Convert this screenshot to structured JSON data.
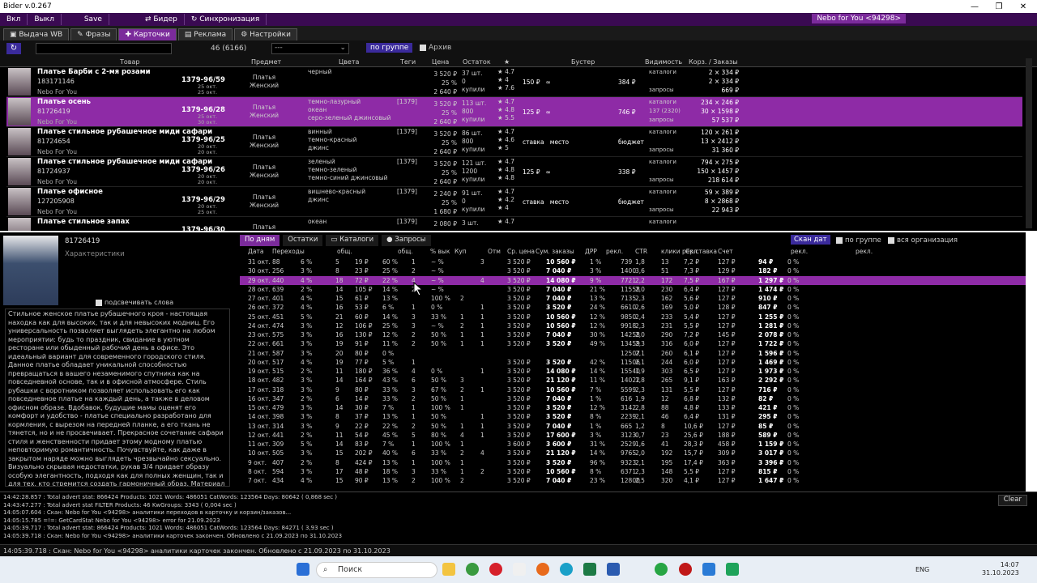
{
  "window": {
    "title": "Bider v.0.267"
  },
  "menu": {
    "items": [
      "Вкл",
      "Выкл",
      "Save",
      "Бидер",
      "Синхронизация"
    ],
    "account": "Nebo for You <94298>"
  },
  "tabs": [
    "Выдача WB",
    "Фразы",
    "Карточки",
    "Реклама",
    "Настройки"
  ],
  "toolbar": {
    "count": "46 (6166)",
    "dropdown": "---",
    "group_button": "по группе",
    "archive": "Архив"
  },
  "columns": [
    "Товар",
    "Предмет",
    "Цвета",
    "Теги",
    "Цена",
    "Остаток",
    "★",
    "Бустер",
    "Видимость",
    "Корз. / Заказы"
  ],
  "products": [
    {
      "name": "Платье Барби с 2-мя розами",
      "id": "183171146",
      "brand": "Nebo For You",
      "article": "1379-96/59",
      "dates": "25 окт.\n25 окт.",
      "subject": "Платья\nЖенский",
      "colors": "черный",
      "tags": "",
      "price": "3 520 ₽\n25 %\n2 640 ₽",
      "stock": "37 шт.\n0\nкупили",
      "rating": "★ 4.7\n★ 4\n★ 7.6",
      "boost": "150 ₽   ∞",
      "budget": "384 ₽",
      "vis": "каталоги\n\nзапросы",
      "orders": "2 × 334 ₽\n2 × 334 ₽\n669 ₽"
    },
    {
      "name": "Платье осень",
      "id": "81726419",
      "brand": "Nebo For You",
      "article": "1379-96/28",
      "dates": "25 окт.\n30 окт.",
      "subject": "Платья\nЖенский",
      "colors": "темно-лазурный\nокеан\nсеро-зеленый джинсовый",
      "tags": "[1379]",
      "price": "3 520 ₽\n25 %\n2 640 ₽",
      "stock": "113 шт.\n800\nкупили",
      "rating": "★ 4.7\n★ 4.8\n★ 5.5",
      "boost": "125 ₽   ∞",
      "budget": "746 ₽",
      "vis": "каталоги\n137 (2320)\nзапросы",
      "orders": "234 × 246 ₽\n30 × 1598 ₽\n57 537 ₽"
    },
    {
      "name": "Платье стильное рубашечное миди сафари",
      "id": "81724654",
      "brand": "Nebo For You",
      "article": "1379-96/25",
      "dates": "20 окт.\n20 окт.",
      "subject": "Платья\nЖенский",
      "colors": "винный\nтемно-красный\nджинс",
      "tags": "[1379]",
      "price": "3 520 ₽\n25 %\n2 640 ₽",
      "stock": "86 шт.\n800\nкупили",
      "rating": "★ 4.7\n★ 4.6\n★ 5",
      "boost": "ставка   место",
      "budget": "бюджет",
      "vis": "каталоги\n\nзапросы",
      "orders": "120 × 261 ₽\n13 × 2412 ₽\n31 360 ₽"
    },
    {
      "name": "Платье стильное рубашечное миди сафари",
      "id": "81724937",
      "brand": "Nebo For You",
      "article": "1379-96/26",
      "dates": "20 окт.\n20 окт.",
      "subject": "Платья\nЖенский",
      "colors": "зеленый\nтемно-зеленый\nтемно-синий джинсовый",
      "tags": "[1379]",
      "price": "3 520 ₽\n25 %\n2 640 ₽",
      "stock": "121 шт.\n1200\nкупили",
      "rating": "★ 4.7\n★ 4.8\n★ 4.8",
      "boost": "125 ₽   ∞",
      "budget": "338 ₽",
      "vis": "каталоги\n\nзапросы",
      "orders": "794 × 275 ₽\n150 × 1457 ₽\n218 614 ₽"
    },
    {
      "name": "Платье офисное",
      "id": "127205908",
      "brand": "Nebo For You",
      "article": "1379-96/29",
      "dates": "20 окт.\n25 окт.",
      "subject": "Платья\nЖенский",
      "colors": "вишнево-красный\nджинс",
      "tags": "[1379]",
      "price": "2 240 ₽\n25 %\n1 680 ₽",
      "stock": "91 шт.\n0\nкупили",
      "rating": "★ 4.7\n★ 4.2\n★ 4",
      "boost": "ставка   место",
      "budget": "бюджет",
      "vis": "каталоги\n\nзапросы",
      "orders": "59 × 389 ₽\n8 × 2868 ₽\n22 943 ₽"
    },
    {
      "name": "Платье стильное запах",
      "id": "",
      "brand": "",
      "article": "1379-96/30",
      "dates": "",
      "subject": "Платья",
      "colors": "океан",
      "tags": "[1379]",
      "price": "2 080 ₽",
      "stock": "3 шт.",
      "rating": "★ 4.7",
      "boost": "",
      "budget": "",
      "vis": "каталоги",
      "orders": ""
    }
  ],
  "detail": {
    "id": "81726419",
    "characteristics": "Характеристики",
    "highlight_words": "подсвечивать слова",
    "description": "Стильное женское платье рубашечного кроя - настоящая находка как для высоких, так и для невысоких модниц. Его универсальность позволяет выглядеть элегантно на любом мероприятии: будь то праздник, свидание в уютном ресторане или обыденный рабочий день в офисе. Это идеальный вариант для современного городского стиля. Данное платье обладает уникальной способностью превращаться в вашего незаменимого спутника как на повседневной основе, так и в офисной атмосфере. Стиль рубашки с воротником позволяет использовать его как повседневное платье на каждый день, а также в деловом офисном образе. Вдобавок, будущие мамы оценят его комфорт и удобство - платье специально разработано для кормления, с вырезом на передней планке, а его ткань не тянется, но и не просвечивает. Прекрасное сочетание сафари стиля и женственности придает этому модному платью неповторимую романтичность. Почувствуйте, как даже в закрытом наряде можно выглядеть чрезвычайно сексуально. Визуально скрывая недостатки, рукав 3/4 придает образу особую элегантность, подходя как для полных женщин, так и для тех, кто стремится создать гармоничный образ. Материал платья обладает плотностью, что делает его"
  },
  "stats_tabs": [
    "По дням",
    "Остатки",
    "Каталоги",
    "Запросы"
  ],
  "stats_controls": {
    "scan": "Скан дат",
    "group": "по группе",
    "all_org": "вся организация"
  },
  "stats_headers": [
    "Дата",
    "Переходы",
    "общ.",
    "общ.",
    "% вык",
    "Куп",
    "Отм",
    "Ср. цена",
    "Сум. заказы",
    "ДРР",
    "рекл.",
    "CTR",
    "клики рекл.",
    "Ср.ставка",
    "Счет",
    "рекл.",
    "рекл."
  ],
  "stats_rows": [
    [
      "31 окт.",
      "88",
      "6 %",
      "5",
      "19 ₽",
      "60 %",
      "1",
      "~ %",
      "",
      "3",
      "3 520 ₽",
      "10 560 ₽",
      "1 %",
      "739",
      "1,8",
      "13",
      "7,2 ₽",
      "127 ₽",
      "94 ₽",
      "0 %"
    ],
    [
      "30 окт.",
      "256",
      "3 %",
      "8",
      "23 ₽",
      "25 %",
      "2",
      "~ %",
      "",
      "",
      "3 520 ₽",
      "7 040 ₽",
      "3 %",
      "1400",
      "3,6",
      "51",
      "7,3 ₽",
      "129 ₽",
      "182 ₽",
      "0 %"
    ],
    [
      "29 окт.",
      "440",
      "4 %",
      "18",
      "72 ₽",
      "22 %",
      "4",
      "~ %",
      "",
      "4",
      "3 520 ₽",
      "14 080 ₽",
      "9 %",
      "7721",
      "2,2",
      "172",
      "7,5 ₽",
      "167 ₽",
      "1 297 ₽",
      "0 %"
    ],
    [
      "28 окт.",
      "639",
      "2 %",
      "14",
      "105 ₽",
      "14 %",
      "2",
      "~ %",
      "",
      "",
      "3 520 ₽",
      "7 040 ₽",
      "21 %",
      "11558",
      "2,0",
      "230",
      "6,4 ₽",
      "127 ₽",
      "1 474 ₽",
      "0 %"
    ],
    [
      "27 окт.",
      "401",
      "4 %",
      "15",
      "61 ₽",
      "13 %",
      "",
      "100 %",
      "2",
      "",
      "3 520 ₽",
      "7 040 ₽",
      "13 %",
      "7135",
      "2,3",
      "162",
      "5,6 ₽",
      "127 ₽",
      "910 ₽",
      "0 %"
    ],
    [
      "26 окт.",
      "372",
      "4 %",
      "16",
      "53 ₽",
      "6 %",
      "1",
      "0 %",
      "",
      "1",
      "3 520 ₽",
      "3 520 ₽",
      "24 %",
      "6610",
      "2,6",
      "169",
      "5,0 ₽",
      "128 ₽",
      "847 ₽",
      "0 %"
    ],
    [
      "25 окт.",
      "451",
      "5 %",
      "21",
      "60 ₽",
      "14 %",
      "3",
      "33 %",
      "1",
      "1",
      "3 520 ₽",
      "10 560 ₽",
      "12 %",
      "9850",
      "2,4",
      "233",
      "5,4 ₽",
      "127 ₽",
      "1 255 ₽",
      "0 %"
    ],
    [
      "24 окт.",
      "474",
      "3 %",
      "12",
      "106 ₽",
      "25 %",
      "3",
      "~ %",
      "2",
      "1",
      "3 520 ₽",
      "10 560 ₽",
      "12 %",
      "9918",
      "2,3",
      "231",
      "5,5 ₽",
      "127 ₽",
      "1 281 ₽",
      "0 %"
    ],
    [
      "23 окт.",
      "575",
      "3 %",
      "16",
      "130 ₽",
      "12 %",
      "2",
      "50 %",
      "1",
      "1",
      "3 520 ₽",
      "7 040 ₽",
      "30 %",
      "14258",
      "2,0",
      "290",
      "7,2 ₽",
      "145 ₽",
      "2 078 ₽",
      "0 %"
    ],
    [
      "22 окт.",
      "661",
      "3 %",
      "19",
      "91 ₽",
      "11 %",
      "2",
      "50 %",
      "1",
      "1",
      "3 520 ₽",
      "3 520 ₽",
      "49 %",
      "13459",
      "2,3",
      "316",
      "6,0 ₽",
      "127 ₽",
      "1 722 ₽",
      "0 %"
    ],
    [
      "21 окт.",
      "587",
      "3 %",
      "20",
      "80 ₽",
      "0 %",
      "",
      "",
      "",
      "",
      "",
      "",
      "",
      "12507",
      "2,1",
      "260",
      "6,1 ₽",
      "127 ₽",
      "1 596 ₽",
      "0 %"
    ],
    [
      "20 окт.",
      "517",
      "4 %",
      "19",
      "77 ₽",
      "5 %",
      "1",
      "",
      "",
      "",
      "3 520 ₽",
      "3 520 ₽",
      "42 %",
      "11506",
      "2,1",
      "244",
      "6,0 ₽",
      "127 ₽",
      "1 469 ₽",
      "0 %"
    ],
    [
      "19 окт.",
      "515",
      "2 %",
      "11",
      "180 ₽",
      "36 %",
      "4",
      "0 %",
      "",
      "1",
      "3 520 ₽",
      "14 080 ₽",
      "14 %",
      "15540",
      "1,9",
      "303",
      "6,5 ₽",
      "127 ₽",
      "1 973 ₽",
      "0 %"
    ],
    [
      "18 окт.",
      "482",
      "3 %",
      "14",
      "164 ₽",
      "43 %",
      "6",
      "50 %",
      "3",
      "",
      "3 520 ₽",
      "21 120 ₽",
      "11 %",
      "14022",
      "1,8",
      "265",
      "9,1 ₽",
      "163 ₽",
      "2 292 ₽",
      "0 %"
    ],
    [
      "17 окт.",
      "318",
      "3 %",
      "9",
      "80 ₽",
      "33 %",
      "3",
      "67 %",
      "2",
      "1",
      "3 520 ₽",
      "10 560 ₽",
      "7 %",
      "5599",
      "2,3",
      "131",
      "5,5 ₽",
      "127 ₽",
      "716 ₽",
      "0 %"
    ],
    [
      "16 окт.",
      "347",
      "2 %",
      "6",
      "14 ₽",
      "33 %",
      "2",
      "50 %",
      "1",
      "",
      "3 520 ₽",
      "7 040 ₽",
      "1 %",
      "616",
      "1,9",
      "12",
      "6,8 ₽",
      "132 ₽",
      "82 ₽",
      "0 %"
    ],
    [
      "15 окт.",
      "479",
      "3 %",
      "14",
      "30 ₽",
      "7 %",
      "1",
      "100 %",
      "1",
      "",
      "3 520 ₽",
      "3 520 ₽",
      "12 %",
      "3142",
      "2,8",
      "88",
      "4,8 ₽",
      "133 ₽",
      "421 ₽",
      "0 %"
    ],
    [
      "14 окт.",
      "398",
      "3 %",
      "8",
      "37 ₽",
      "13 %",
      "1",
      "50 %",
      "",
      "1",
      "3 520 ₽",
      "3 520 ₽",
      "8 %",
      "2239",
      "2,1",
      "46",
      "6,4 ₽",
      "131 ₽",
      "295 ₽",
      "0 %"
    ],
    [
      "13 окт.",
      "314",
      "3 %",
      "9",
      "22 ₽",
      "22 %",
      "2",
      "50 %",
      "1",
      "1",
      "3 520 ₽",
      "7 040 ₽",
      "1 %",
      "665",
      "1,2",
      "8",
      "10,6 ₽",
      "127 ₽",
      "85 ₽",
      "0 %"
    ],
    [
      "12 окт.",
      "441",
      "2 %",
      "11",
      "54 ₽",
      "45 %",
      "5",
      "80 %",
      "4",
      "1",
      "3 520 ₽",
      "17 600 ₽",
      "3 %",
      "3123",
      "0,7",
      "23",
      "25,6 ₽",
      "188 ₽",
      "589 ₽",
      "0 %"
    ],
    [
      "11 окт.",
      "309",
      "5 %",
      "14",
      "83 ₽",
      "7 %",
      "1",
      "100 %",
      "1",
      "",
      "3 600 ₽",
      "3 600 ₽",
      "31 %",
      "2529",
      "1,6",
      "41",
      "28,3 ₽",
      "458 ₽",
      "1 159 ₽",
      "0 %"
    ],
    [
      "10 окт.",
      "505",
      "3 %",
      "15",
      "202 ₽",
      "40 %",
      "6",
      "33 %",
      "2",
      "4",
      "3 520 ₽",
      "21 120 ₽",
      "14 %",
      "9765",
      "2,0",
      "192",
      "15,7 ₽",
      "309 ₽",
      "3 017 ₽",
      "0 %"
    ],
    [
      "9 окт.",
      "407",
      "2 %",
      "8",
      "424 ₽",
      "13 %",
      "1",
      "100 %",
      "1",
      "",
      "3 520 ₽",
      "3 520 ₽",
      "96 %",
      "9323",
      "2,1",
      "195",
      "17,4 ₽",
      "363 ₽",
      "3 396 ₽",
      "0 %"
    ],
    [
      "8 окт.",
      "594",
      "3 %",
      "17",
      "48 ₽",
      "18 %",
      "3",
      "33 %",
      "1",
      "2",
      "3 520 ₽",
      "10 560 ₽",
      "8 %",
      "6371",
      "2,3",
      "148",
      "5,5 ₽",
      "127 ₽",
      "815 ₽",
      "0 %"
    ],
    [
      "7 окт.",
      "434",
      "4 %",
      "15",
      "90 ₽",
      "13 %",
      "2",
      "100 %",
      "2",
      "",
      "3 520 ₽",
      "7 040 ₽",
      "23 %",
      "12800",
      "2,5",
      "320",
      "4,1 ₽",
      "127 ₽",
      "1 647 ₽",
      "0 %"
    ]
  ],
  "log": {
    "lines": [
      "14:42:28.857  : Total advert stat: 866424  Products: 1021  Words: 486051  CatWords: 123564  Days: 80642  ( 0,868 sec )",
      "14:43:47.277  : Total advert stat FILTER Products: 46  KwGroups: 3343  ( 0,004 sec )",
      "14:05:07.604  : Скан: Nebo for You <94298> аналитики переходов в карточку и корзин/заказов...",
      "14:05:15.785  =!=: GetCardStat Nebo for You <94298> error for 21.09.2023",
      "14:05:39.717  : Total advert stat: 866424  Products: 1021  Words: 486051  CatWords: 123564  Days: 84271  ( 3,93 sec )",
      "14:05:39.718  : Скан: Nebo for You <94298> аналитики карточек закончен.  Обновлено с 21.09.2023 по 31.10.2023"
    ],
    "clear": "Clear"
  },
  "status": "14:05:39.718  : Скан: Nebo for You <94298> аналитики карточек закончен.  Обновлено с 21.09.2023 по 31.10.2023",
  "taskbar": {
    "search": "Поиск",
    "lang": "ENG",
    "time": "14:07",
    "date": "31.10.2023"
  }
}
